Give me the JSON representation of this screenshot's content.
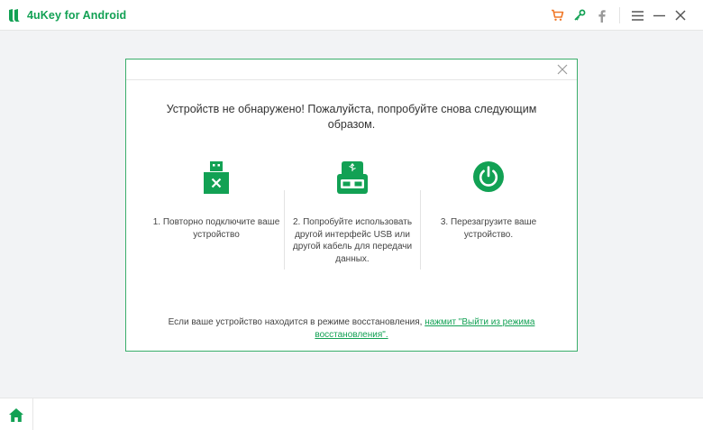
{
  "app": {
    "title": "4uKey for Android",
    "brand_color": "#12a154",
    "cart_color": "#f07828",
    "key_color": "#12a154"
  },
  "titlebar": {
    "icons": [
      "cart-icon",
      "key-icon",
      "facebook-icon",
      "menu-icon",
      "minimize-icon",
      "close-icon"
    ]
  },
  "dialog": {
    "message": "Устройств не обнаружено! Пожалуйста, попробуйте снова следующим образом.",
    "steps": [
      {
        "icon": "usb-disconnected-icon",
        "text": "1. Повторно подключите ваше устройство"
      },
      {
        "icon": "usb-port-icon",
        "text": "2. Попробуйте использовать другой интерфейс USB или другой кабель для передачи данных."
      },
      {
        "icon": "power-icon",
        "text": "3. Перезагрузите ваше устройство."
      }
    ],
    "footer_text": "Если ваше устройство находится в режиме восстановления, ",
    "footer_link": "нажмит \"Выйти из режима восстановления\"."
  },
  "bottombar": {
    "icons": [
      "home-icon"
    ]
  }
}
